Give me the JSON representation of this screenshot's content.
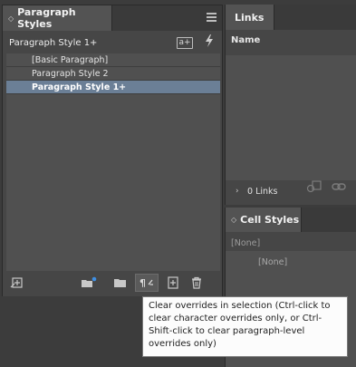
{
  "paragraph_styles": {
    "tab_title": "Paragraph Styles",
    "current_style": "Paragraph Style 1+",
    "new_from_selection_label": "a+",
    "styles": [
      {
        "label": "[Basic Paragraph]",
        "selected": false
      },
      {
        "label": "Paragraph Style 2",
        "selected": false
      },
      {
        "label": "Paragraph Style 1+",
        "selected": true
      }
    ],
    "footer_icons": [
      "load-styles-icon",
      "new-style-group-icon",
      "folder-icon",
      "clear-overrides-icon",
      "new-style-icon",
      "delete-icon"
    ]
  },
  "links": {
    "tab_title": "Links",
    "column_header": "Name",
    "count_text": "0 Links"
  },
  "cell_styles": {
    "tab_title": "Cell Styles",
    "current_style": "[None]",
    "styles": [
      "[None]"
    ]
  },
  "tooltip": {
    "text": "Clear overrides in selection (Ctrl-click to clear character overrides only, or Ctrl-Shift-click to clear paragraph-level overrides only)"
  },
  "colors": {
    "panel_bg": "#464646",
    "list_bg": "#505050",
    "selected_row": "#6b7f96",
    "tooltip_bg": "#fcfcfc"
  }
}
